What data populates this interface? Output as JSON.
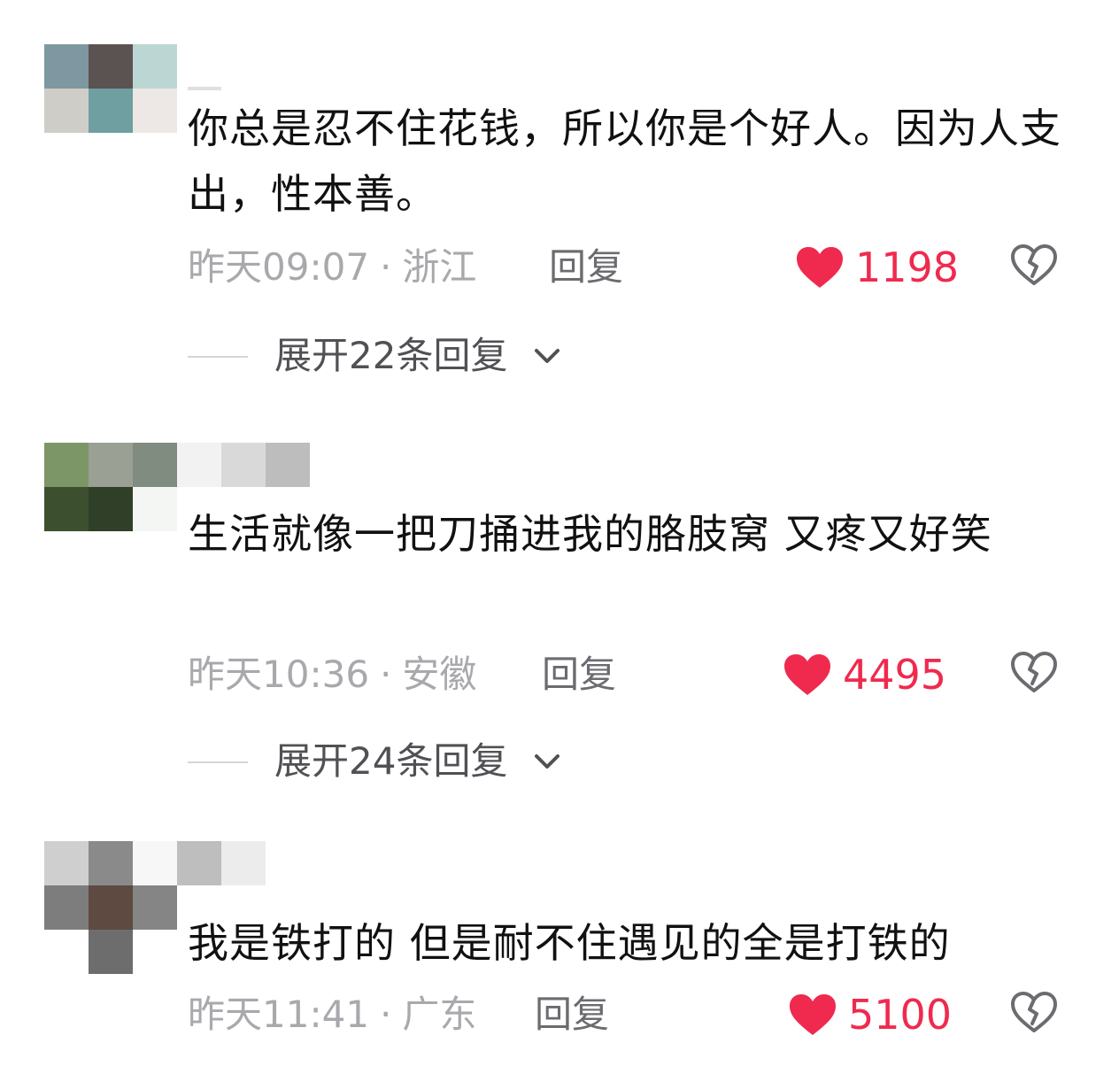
{
  "colors": {
    "like_red": "#ef2a4e",
    "meta_gray": "#a8a8ad",
    "reply_gray": "#6b6b70",
    "text": "#111111"
  },
  "comments": [
    {
      "text": "你总是忍不住花钱，所以你是个好人。因为人支出，性本善。",
      "time": "昨天09:07",
      "separator": "·",
      "location": "浙江",
      "reply_label": "回复",
      "likes": "1198",
      "like_icon": "heart-icon",
      "dislike_icon": "broken-heart-icon",
      "expand_label": "展开22条回复",
      "expand_icon": "chevron-down-icon"
    },
    {
      "text": "生活就像一把刀捅进我的胳肢窝 又疼又好笑",
      "time": "昨天10:36",
      "separator": "·",
      "location": "安徽",
      "reply_label": "回复",
      "likes": "4495",
      "like_icon": "heart-icon",
      "dislike_icon": "broken-heart-icon",
      "expand_label": "展开24条回复",
      "expand_icon": "chevron-down-icon"
    },
    {
      "text": "我是铁打的 但是耐不住遇见的全是打铁的",
      "time": "昨天11:41",
      "separator": "·",
      "location": "广东",
      "reply_label": "回复",
      "likes": "5100",
      "like_icon": "heart-icon",
      "dislike_icon": "broken-heart-icon"
    }
  ]
}
